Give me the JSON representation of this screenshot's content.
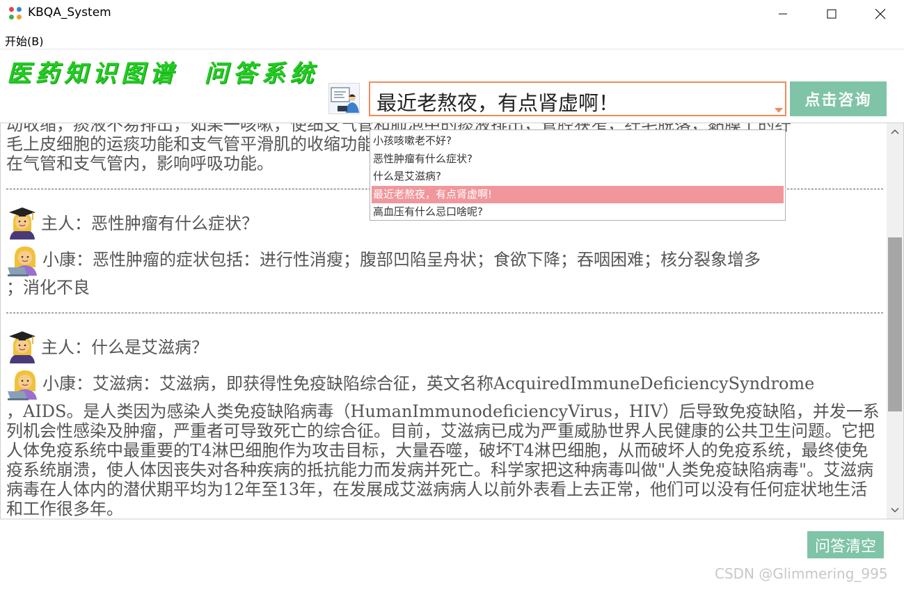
{
  "window": {
    "title": "KBQA_System",
    "minimize_glyph": "—",
    "maximize_glyph": "☐",
    "close_glyph": "✕"
  },
  "menu": {
    "items": [
      {
        "label": "开始(B)"
      }
    ]
  },
  "header": {
    "logo_title": "医药知识图谱  问答系统",
    "logo_color": "#22cc22"
  },
  "query": {
    "value": "最近老熬夜，有点肾虚啊！",
    "ask_label": "点击咨询",
    "border_color": "#f08a5d",
    "button_color": "#7fc4a6"
  },
  "dropdown": {
    "items": [
      {
        "label": "小孩咳嗽老不好?"
      },
      {
        "label": "恶性肿瘤有什么症状?"
      },
      {
        "label": "什么是艾滋病?"
      },
      {
        "label": "最近老熬夜，有点肾虚啊!"
      },
      {
        "label": "高血压有什么忌口啥呢?"
      }
    ],
    "selected_index": 3,
    "selected_color": "#f1969b"
  },
  "chat": {
    "prev_answer_lines": [
      "动收缩，痰液不易排出，如果一咳嗽，使细支气管和肺泡中的痰液排出，管腔狭窄，纤毛脱落，黏膜上的纤",
      "毛上皮细胞的运痰功能和支气管平滑肌的收缩功能受到损害，从而使痰液不能排出，导致大量痰液蓄积",
      "在气管和支气管内，影响呼吸功能。"
    ],
    "conversations": [
      {
        "question": "主人：恶性肿瘤有什么症状？",
        "answer_first": "小康：恶性肿瘤的症状包括：进行性消瘦；腹部凹陷呈舟状；食欲下降；吞咽困难；核分裂象增多",
        "answer_rest": "；消化不良"
      },
      {
        "question": "主人：什么是艾滋病？",
        "answer_first": "小康：艾滋病：艾滋病，即获得性免疫缺陷综合征，英文名称AcquiredImmuneDeficiencySyndrome",
        "answer_rest": "，AIDS。是人类因为感染人类免疫缺陷病毒（HumanImmunodeficiencyVirus，HIV）后导致免疫缺陷，并发一系列机会性感染及肿瘤，严重者可导致死亡的综合征。目前，艾滋病已成为严重威胁世界人民健康的公共卫生问题。它把人体免疫系统中最重要的T4淋巴细胞作为攻击目标，大量吞噬，破坏T4淋巴细胞，从而破坏人的免疫系统，最终使免疫系统崩溃，使人体因丧失对各种疾病的抵抗能力而发病并死亡。科学家把这种病毒叫做\"人类免疫缺陷病毒\"。艾滋病病毒在人体内的潜伏期平均为12年至13年，在发展成艾滋病病人以前外表看上去正常，他们可以没有任何症状地生活和工作很多年。"
      }
    ],
    "scroll_position": 0.52
  },
  "footer": {
    "clear_label": "问答清空",
    "watermark": "CSDN @Glimmering_995"
  },
  "icons": {
    "app": "app-dots-icon",
    "user": "graduate-woman-icon",
    "bot": "woman-laptop-icon",
    "ask": "teacher-presentation-icon"
  }
}
